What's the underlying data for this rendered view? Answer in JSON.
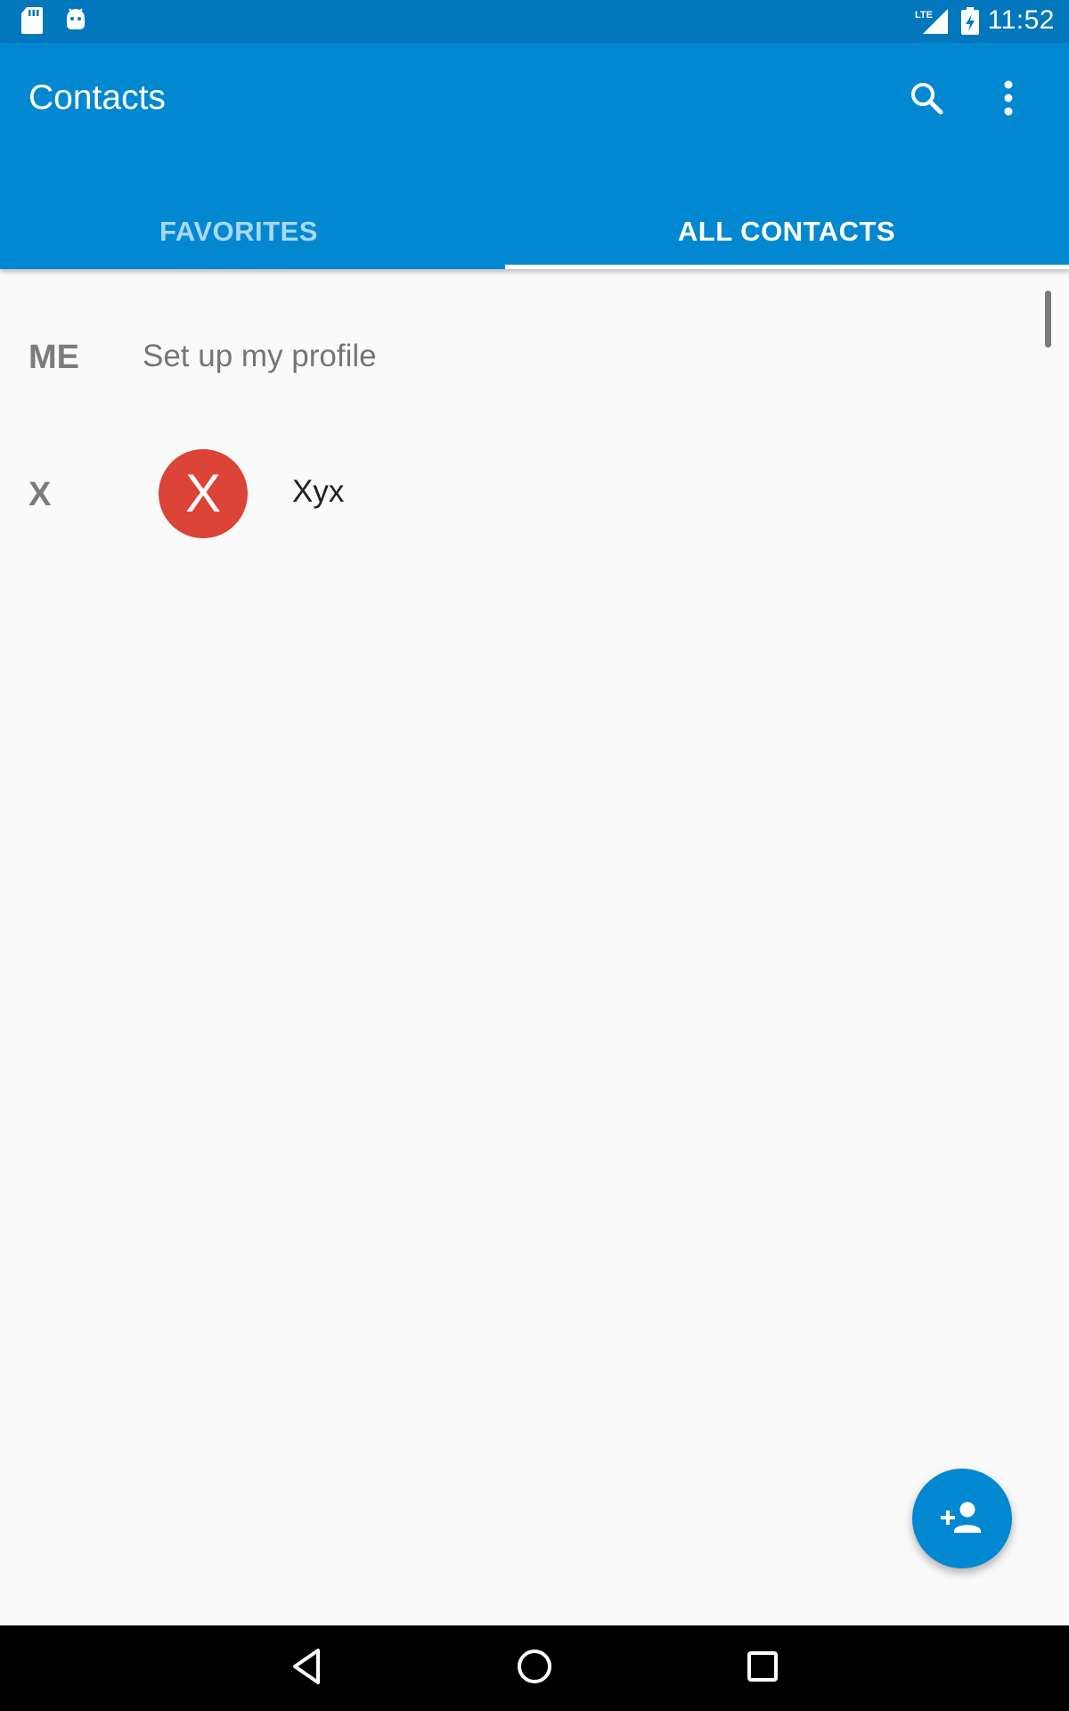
{
  "status_bar": {
    "time": "11:52",
    "network_label": "LTE",
    "left_icons": [
      "sd-card-icon",
      "android-debug-icon"
    ],
    "right_icons": [
      "lte-signal-icon",
      "battery-charging-icon"
    ]
  },
  "app_bar": {
    "title": "Contacts",
    "actions": [
      "search-icon",
      "more-vert-icon"
    ]
  },
  "tabs": [
    {
      "label": "FAVORITES",
      "selected": false
    },
    {
      "label": "ALL CONTACTS",
      "selected": true
    }
  ],
  "me_section": {
    "letter": "ME",
    "text": "Set up my profile"
  },
  "contacts": [
    {
      "section_letter": "X",
      "avatar_letter": "X",
      "name": "Xyx",
      "avatar_color": "#db4437"
    }
  ],
  "fab": {
    "icon": "add-person-icon"
  },
  "nav_bar": {
    "buttons": [
      "back-icon",
      "home-icon",
      "recents-icon"
    ]
  },
  "colors": {
    "primary": "#0288d1",
    "primary_dark": "#0277bd",
    "avatar": "#db4437",
    "inactive_tab": "#a9d8f4"
  }
}
